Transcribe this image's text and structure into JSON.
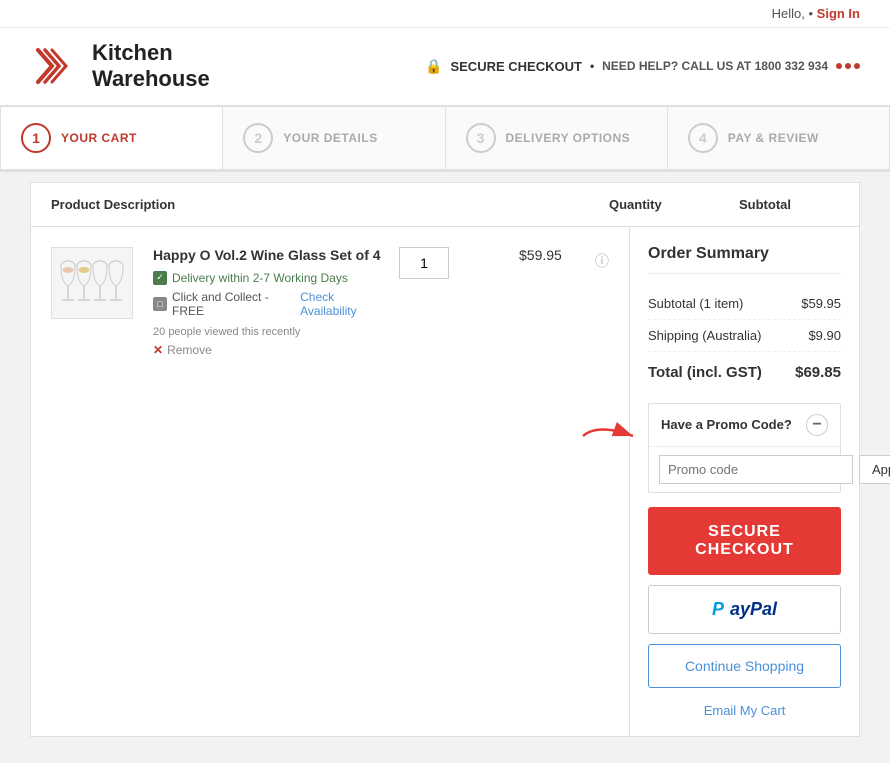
{
  "topBar": {
    "hello": "Hello,",
    "separator": "•",
    "signIn": "Sign In"
  },
  "header": {
    "logoLine1": "Kitchen",
    "logoLine2": "Warehouse",
    "secure": "SECURE CHECKOUT",
    "separator": "•",
    "helpText": "NEED HELP? CALL US AT 1800 332 934"
  },
  "stepper": {
    "steps": [
      {
        "number": "1",
        "label": "YOUR CART",
        "active": true
      },
      {
        "number": "2",
        "label": "YOUR DETAILS",
        "active": false
      },
      {
        "number": "3",
        "label": "DELIVERY OPTIONS",
        "active": false
      },
      {
        "number": "4",
        "label": "PAY & REVIEW",
        "active": false
      }
    ]
  },
  "cartTable": {
    "colProduct": "Product Description",
    "colQuantity": "Quantity",
    "colSubtotal": "Subtotal"
  },
  "product": {
    "name": "Happy O Vol.2 Wine Glass Set of 4",
    "delivery": "Delivery within 2-7 Working Days",
    "collect": "Click and Collect - FREE",
    "checkAvail": "Check Availability",
    "viewedCount": "20",
    "viewedText": "people viewed this recently",
    "remove": "Remove",
    "quantity": "1",
    "subtotal": "$59.95"
  },
  "orderSummary": {
    "title": "Order Summary",
    "subtotalLabel": "Subtotal (1 item)",
    "subtotalValue": "$59.95",
    "shippingLabel": "Shipping (Australia)",
    "shippingValue": "$9.90",
    "totalLabel": "Total (incl. GST)",
    "totalValue": "$69.85"
  },
  "promo": {
    "header": "Have a Promo Code?",
    "placeholder": "Promo code",
    "applyLabel": "Apply"
  },
  "buttons": {
    "secureCheckout": "SECURE CHECKOUT",
    "paypalP": "P",
    "paypalAyPal": "ayPal",
    "continueShopping": "Continue Shopping",
    "emailCart": "Email My Cart"
  }
}
